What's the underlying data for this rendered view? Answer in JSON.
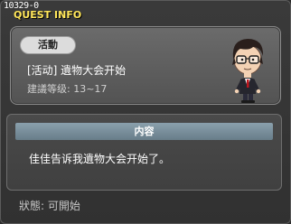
{
  "window": {
    "quest_id": "10329-0",
    "title": "QUEST INFO"
  },
  "quest": {
    "category": "活動",
    "name": "[活动] 遺物大会开始",
    "level_label": "建議等级: 13~17"
  },
  "content": {
    "header": "内容",
    "text": "佳佳告诉我遺物大会开始了。"
  },
  "status": {
    "text": "狀態:  可開始"
  },
  "colors": {
    "title_yellow": "#ffe65a",
    "header_bar": "#7a909c",
    "panel_gray": "#5e5e5e"
  },
  "npc": {
    "icon": "npc-glasses-man-icon"
  }
}
